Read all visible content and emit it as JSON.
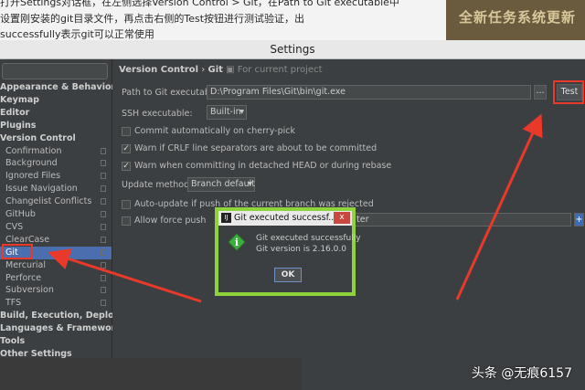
{
  "article": {
    "line1": "打开Settings对话框，在左侧选择Version Control > Git，在Path to Git executable中",
    "line2": "设置刚安装的git目录文件，再点击右侧的Test按钮进行测试验证，出",
    "line3": "successfully表示git可以正常使用",
    "banner_text": "全新任务系统更新"
  },
  "window": {
    "title": "Settings"
  },
  "sidebar": {
    "items": [
      {
        "label": "Appearance & Behavior",
        "level": "top"
      },
      {
        "label": "Keymap",
        "level": "top"
      },
      {
        "label": "Editor",
        "level": "top"
      },
      {
        "label": "Plugins",
        "level": "top"
      },
      {
        "label": "Version Control",
        "level": "top"
      },
      {
        "label": "Confirmation",
        "level": "child"
      },
      {
        "label": "Background",
        "level": "child"
      },
      {
        "label": "Ignored Files",
        "level": "child"
      },
      {
        "label": "Issue Navigation",
        "level": "child"
      },
      {
        "label": "Changelist Conflicts",
        "level": "child"
      },
      {
        "label": "GitHub",
        "level": "child"
      },
      {
        "label": "CVS",
        "level": "child"
      },
      {
        "label": "ClearCase",
        "level": "child"
      },
      {
        "label": "Git",
        "level": "child",
        "selected": true
      },
      {
        "label": "Mercurial",
        "level": "child"
      },
      {
        "label": "Perforce",
        "level": "child"
      },
      {
        "label": "Subversion",
        "level": "child"
      },
      {
        "label": "TFS",
        "level": "child"
      },
      {
        "label": "Build, Execution, Deployment",
        "level": "top"
      },
      {
        "label": "Languages & Frameworks",
        "level": "top"
      },
      {
        "label": "Tools",
        "level": "top"
      },
      {
        "label": "Other Settings",
        "level": "top"
      }
    ]
  },
  "panel": {
    "breadcrumb": {
      "section": "Version Control",
      "separator": "›",
      "page": "Git",
      "scope": "For current project"
    },
    "path_label": "Path to Git executable:",
    "path_value": "D:\\Program Files\\Git\\bin\\git.exe",
    "browse_label": "...",
    "test_label": "Test",
    "ssh_label": "SSH executable:",
    "ssh_value": "Built-in",
    "commit_cherry_pick": {
      "label": "Commit automatically on cherry-pick",
      "checked": false
    },
    "crlf_warn": {
      "label": "Warn if CRLF line separators are about to be committed",
      "checked": true
    },
    "detached_warn": {
      "label": "Warn when committing in detached HEAD or during rebase",
      "checked": true
    },
    "update_method_label": "Update method:",
    "update_method_value": "Branch default",
    "auto_update": {
      "label": "Auto-update if push of the current branch was rejected",
      "checked": false
    },
    "force_push": {
      "label": "Allow force push",
      "checked": false
    },
    "protected_suffix": "ter",
    "add_label": "+"
  },
  "dialog": {
    "title": "Git executed successf...",
    "close": "x",
    "message1": "Git executed successfully",
    "message2": "Git version is 2.16.0.0",
    "ok": "OK"
  },
  "watermark": "头条 @无痕6157",
  "colors": {
    "annotation": "#e8392b",
    "dialog_border": "#8ed33b",
    "selection": "#4b6eaf"
  }
}
